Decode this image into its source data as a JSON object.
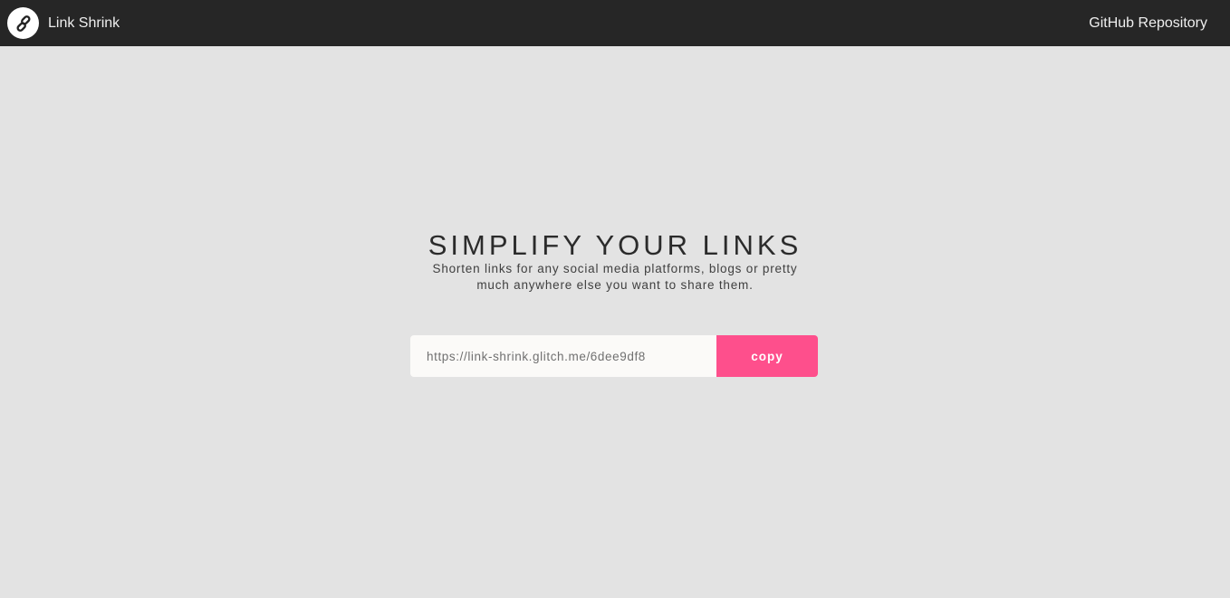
{
  "navbar": {
    "brand_icon": "chain-link-icon",
    "brand_name": "Link Shrink",
    "github_link": "GitHub Repository"
  },
  "hero": {
    "title": "SIMPLIFY YOUR LINKS",
    "subtitle": "Shorten links for any social media platforms, blogs or pretty much anywhere else you want to share them."
  },
  "shortener": {
    "url_value": "https://link-shrink.glitch.me/6dee9df8",
    "copy_label": "copy"
  },
  "colors": {
    "navbar_bg": "#262626",
    "page_bg": "#e3e3e3",
    "accent": "#fe4f8c"
  }
}
